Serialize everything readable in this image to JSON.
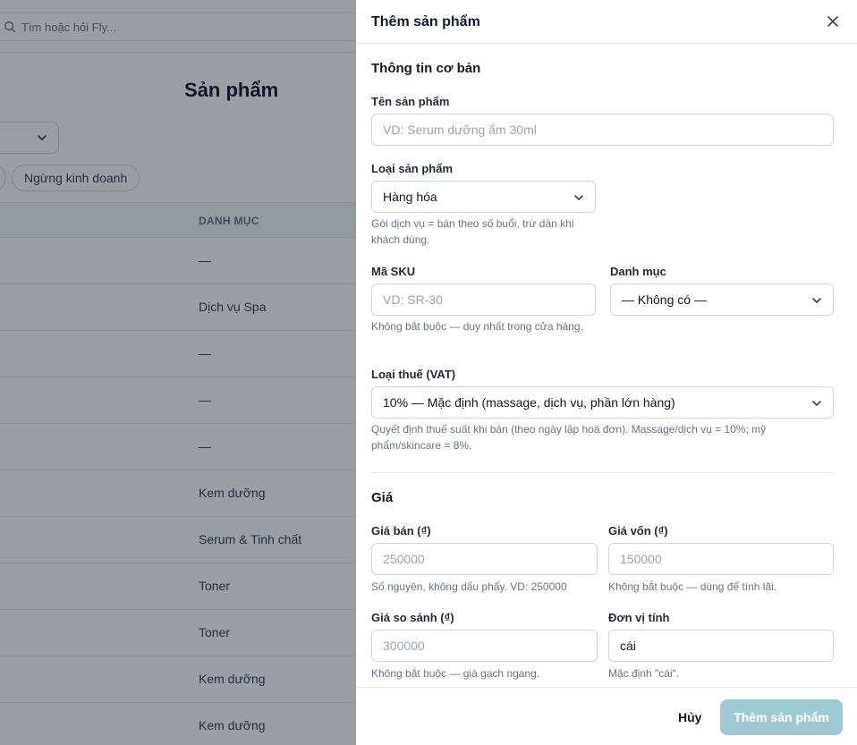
{
  "background": {
    "search": {
      "placeholder": "Tìm hoặc hỏi Fly..."
    },
    "page_title": "Sản phẩm",
    "filter_chip": "Ngừng kinh doanh",
    "table": {
      "column_header": "DANH MỤC",
      "categories": [
        "—",
        "Dịch vụ Spa",
        "—",
        "—",
        "—",
        "Kem dưỡng",
        "Serum & Tinh chất",
        "Toner",
        "Toner",
        "Kem dưỡng",
        "Kem dưỡng"
      ]
    }
  },
  "drawer": {
    "title": "Thêm sản phẩm",
    "basic_section": {
      "title": "Thông tin cơ bản",
      "name_label": "Tên sản phẩm",
      "name_placeholder": "VD: Serum dưỡng ẩm 30ml",
      "type_label": "Loại sản phẩm",
      "type_value": "Hàng hóa",
      "type_help": "Gói dịch vụ = bán theo số buổi, trừ dần khi khách dùng.",
      "sku_label": "Mã SKU",
      "sku_placeholder": "VD: SR-30",
      "sku_help": "Không bắt buộc — duy nhất trong cửa hàng.",
      "category_label": "Danh mục",
      "category_value": "— Không có —",
      "vat_label": "Loại thuế (VAT)",
      "vat_value": "10% — Mặc định (massage, dịch vụ, phần lớn hàng)",
      "vat_help": "Quyết định thuế suất khi bán (theo ngày lập hoá đơn). Massage/dịch vụ = 10%; mỹ phẩm/skincare = 8%."
    },
    "price_section": {
      "title": "Giá",
      "sell_label": "Giá bán (₫)",
      "sell_placeholder": "250000",
      "sell_help": "Số nguyên, không dấu phẩy. VD: 250000",
      "cost_label": "Giá vốn (₫)",
      "cost_placeholder": "150000",
      "cost_help": "Không bắt buộc — dùng để tính lãi.",
      "compare_label": "Giá so sánh (₫)",
      "compare_placeholder": "300000",
      "compare_help": "Không bắt buộc — giá gạch ngang.",
      "unit_label": "Đơn vị tính",
      "unit_value": "cái",
      "unit_help": "Mặc định \"cái\"."
    },
    "footer": {
      "cancel_label": "Hủy",
      "submit_label": "Thêm sản phẩm"
    }
  },
  "colors": {
    "overlay": "#111827",
    "submit_disabled": "#9fcad4"
  }
}
